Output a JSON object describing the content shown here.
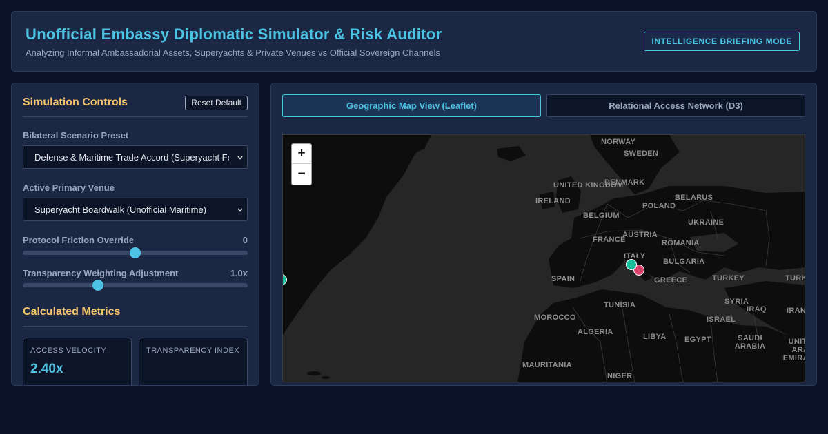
{
  "header": {
    "title": "Unofficial Embassy Diplomatic Simulator & Risk Auditor",
    "subtitle": "Analyzing Informal Ambassadorial Assets, Superyachts & Private Venues vs Official Sovereign Channels",
    "mode_badge": "INTELLIGENCE BRIEFING MODE"
  },
  "controls": {
    "title": "Simulation Controls",
    "reset_label": "Reset Default",
    "scenario": {
      "label": "Bilateral Scenario Preset",
      "selected": "Defense & Maritime Trade Accord (Superyacht Focus)"
    },
    "venue": {
      "label": "Active Primary Venue",
      "selected": "Superyacht Boardwalk (Unofficial Maritime)"
    },
    "friction": {
      "label": "Protocol Friction Override",
      "value": 0,
      "display": "0",
      "min": -100,
      "max": 100
    },
    "transparency": {
      "label": "Transparency Weighting Adjustment",
      "value": 1.0,
      "display": "1.0x",
      "min": 0,
      "max": 3
    }
  },
  "metrics": {
    "title": "Calculated Metrics",
    "cards": [
      {
        "label": "ACCESS VELOCITY",
        "value": "2.40x"
      },
      {
        "label": "TRANSPARENCY INDEX",
        "value": ""
      }
    ]
  },
  "tabs": [
    {
      "label": "Geographic Map View (Leaflet)",
      "active": true
    },
    {
      "label": "Relational Access Network (D3)",
      "active": false
    }
  ],
  "map": {
    "zoom_in": "+",
    "zoom_out": "−",
    "labels": [
      "NORWAY",
      "SWEDEN",
      "UNITED KINGDOM",
      "DENMARK",
      "BELARUS",
      "IRELAND",
      "POLAND",
      "BELGIUM",
      "UKRAINE",
      "FRANCE",
      "AUSTRIA",
      "ROMANIA",
      "ITALY",
      "BULGARIA",
      "SPAIN",
      "GREECE",
      "TURKEY",
      "TURK",
      "TUNISIA",
      "SYRIA",
      "IRAQ",
      "MOROCCO",
      "ISRAEL",
      "IRAN",
      "ALGERIA",
      "LIBYA",
      "EGYPT",
      "SAUDI ARABIA",
      "UNITED ARAB EMIRATES",
      "MAURITANIA",
      "NIGER"
    ],
    "marker_colors": {
      "official": "#1abc9c",
      "unofficial": "#e0456f"
    }
  }
}
